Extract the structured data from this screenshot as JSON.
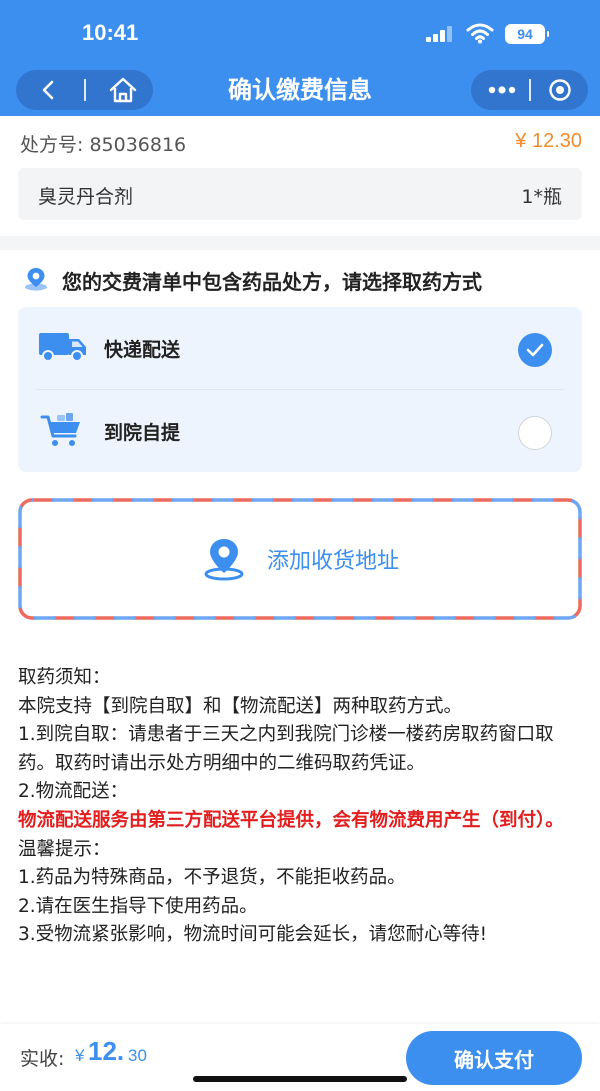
{
  "status_bar": {
    "time": "10:41",
    "battery": "94"
  },
  "nav": {
    "title": "确认缴费信息"
  },
  "prescription": {
    "label": "处方号: 85036816",
    "price": "¥ 12.30",
    "drug_name": "臭灵丹合剂",
    "drug_qty": "1*瓶"
  },
  "delivery": {
    "notice": "您的交费清单中包含药品处方，请选择取药方式",
    "options": [
      {
        "label": "快递配送",
        "icon": "truck-icon",
        "selected": true
      },
      {
        "label": "到院自提",
        "icon": "cart-icon",
        "selected": false
      }
    ]
  },
  "address": {
    "label": "添加收货地址"
  },
  "instructions": {
    "title": "取药须知：",
    "intro": "本院支持【到院自取】和【物流配送】两种取药方式。",
    "item1": "1.到院自取：请患者于三天之内到我院门诊楼一楼药房取药窗口取药。取药时请出示处方明细中的二维码取药凭证。",
    "item2": "2.物流配送：",
    "warning": "物流配送服务由第三方配送平台提供，会有物流费用产生（到付）。",
    "tips_title": "温馨提示：",
    "tip1": "1.药品为特殊商品，不予退货，不能拒收药品。",
    "tip2": "2.请在医生指导下使用药品。",
    "tip3": "3.受物流紧张影响，物流时间可能会延长，请您耐心等待!"
  },
  "footer": {
    "total_label": "实收:",
    "total_currency": "¥",
    "total_integer": "12.",
    "total_decimal": "30",
    "pay_label": "确认支付"
  },
  "colors": {
    "primary": "#3d8fef",
    "price": "#f08c2c",
    "warning": "#e21e1e",
    "dash_red": "#ec6a5e",
    "dash_blue": "#6ea6f4"
  }
}
